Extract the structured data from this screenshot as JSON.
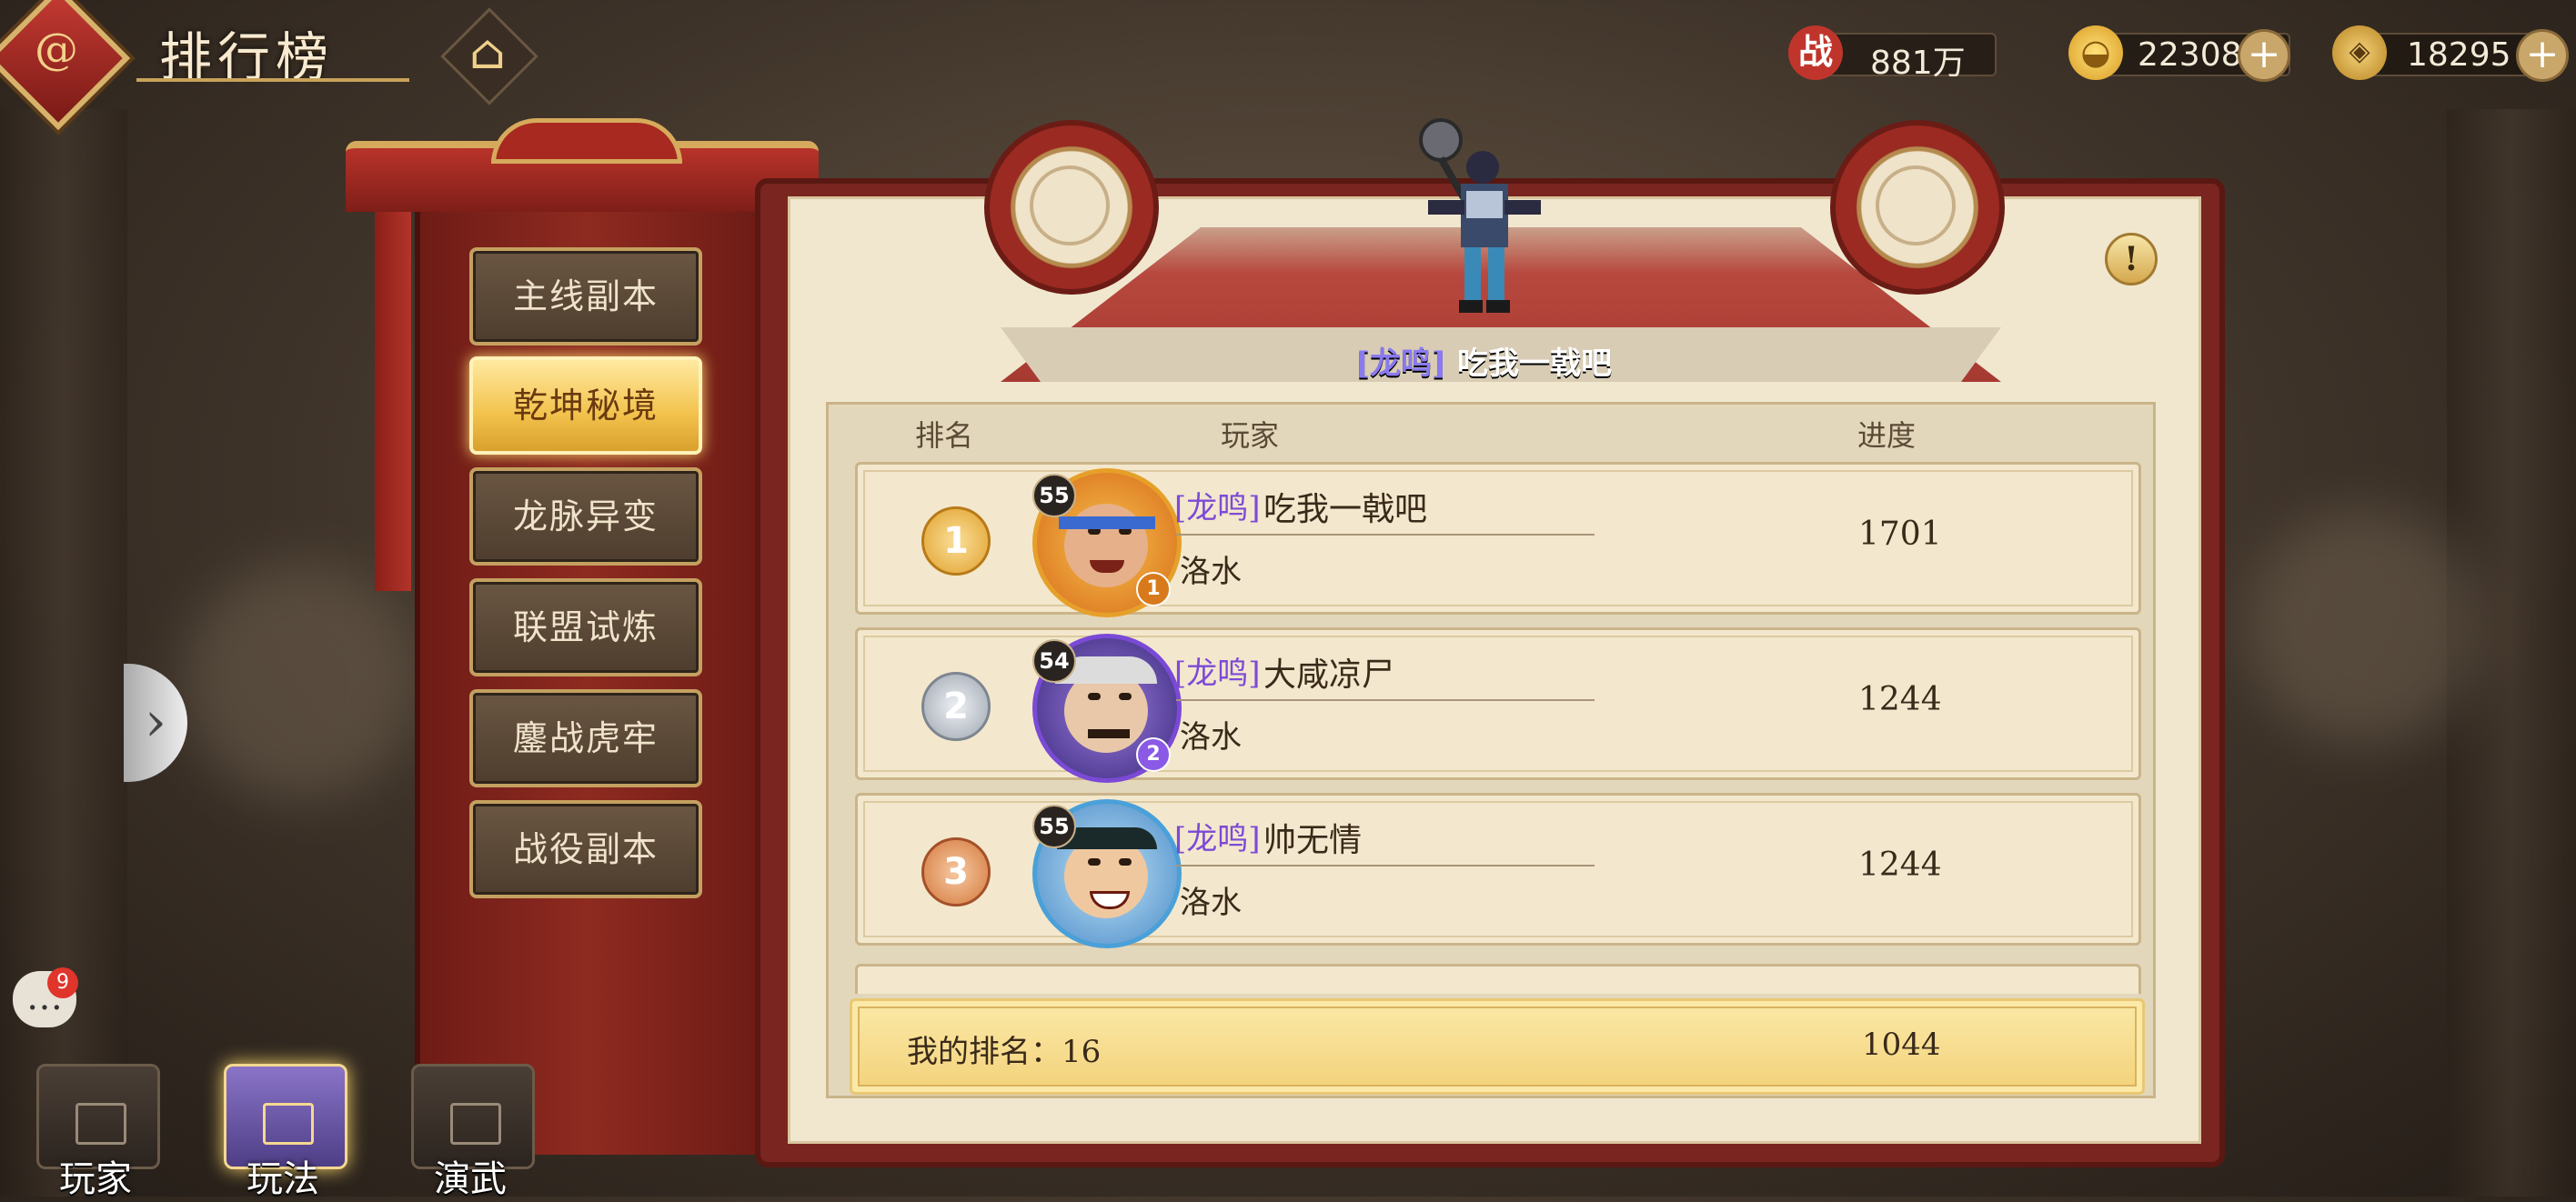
{
  "header": {
    "title": "排行榜",
    "logo_icon": "logo-swirl",
    "home_icon": "home-icon"
  },
  "resources": {
    "power": {
      "icon": "战",
      "value": "881万",
      "color": "#c0352b"
    },
    "gold_ingot": {
      "value": "22308"
    },
    "coin": {
      "value": "18295"
    }
  },
  "sidebar": {
    "items": [
      {
        "label": "主线副本",
        "active": false
      },
      {
        "label": "乾坤秘境",
        "active": true
      },
      {
        "label": "龙脉异变",
        "active": false
      },
      {
        "label": "联盟试炼",
        "active": false
      },
      {
        "label": "鏖战虎牢",
        "active": false
      },
      {
        "label": "战役副本",
        "active": false
      }
    ]
  },
  "chat": {
    "badge_count": "9"
  },
  "bottom_nav": [
    {
      "label": "玩家",
      "active": false
    },
    {
      "label": "玩法",
      "active": true
    },
    {
      "label": "演武",
      "active": false
    }
  ],
  "champion": {
    "guild": "[龙鸣]",
    "name": "吃我一戟吧"
  },
  "table": {
    "columns": {
      "rank": "排名",
      "player": "玩家",
      "progress": "进度"
    },
    "rows": [
      {
        "rank": "1",
        "level": "55",
        "guild": "[龙鸣]",
        "name": "吃我一戟吧",
        "server": "洛水",
        "progress": "1701",
        "frame_color": "#e6a02a",
        "corner_color": "#d87a1c"
      },
      {
        "rank": "2",
        "level": "54",
        "guild": "[龙鸣]",
        "name": "大咸凉尸",
        "server": "洛水",
        "progress": "1244",
        "frame_color": "#7a4ad6",
        "corner_color": "#8a5ae6"
      },
      {
        "rank": "3",
        "level": "55",
        "guild": "[龙鸣]",
        "name": "帅无情",
        "server": "洛水",
        "progress": "1244",
        "frame_color": "#4aa0d8",
        "corner_color": "#3a8ad0"
      }
    ]
  },
  "my_rank": {
    "label": "我的排名：16",
    "progress": "1044"
  },
  "colors": {
    "accent_gold": "#f2c24c",
    "frame_red": "#7a2520",
    "parchment": "#f1e7cf"
  }
}
